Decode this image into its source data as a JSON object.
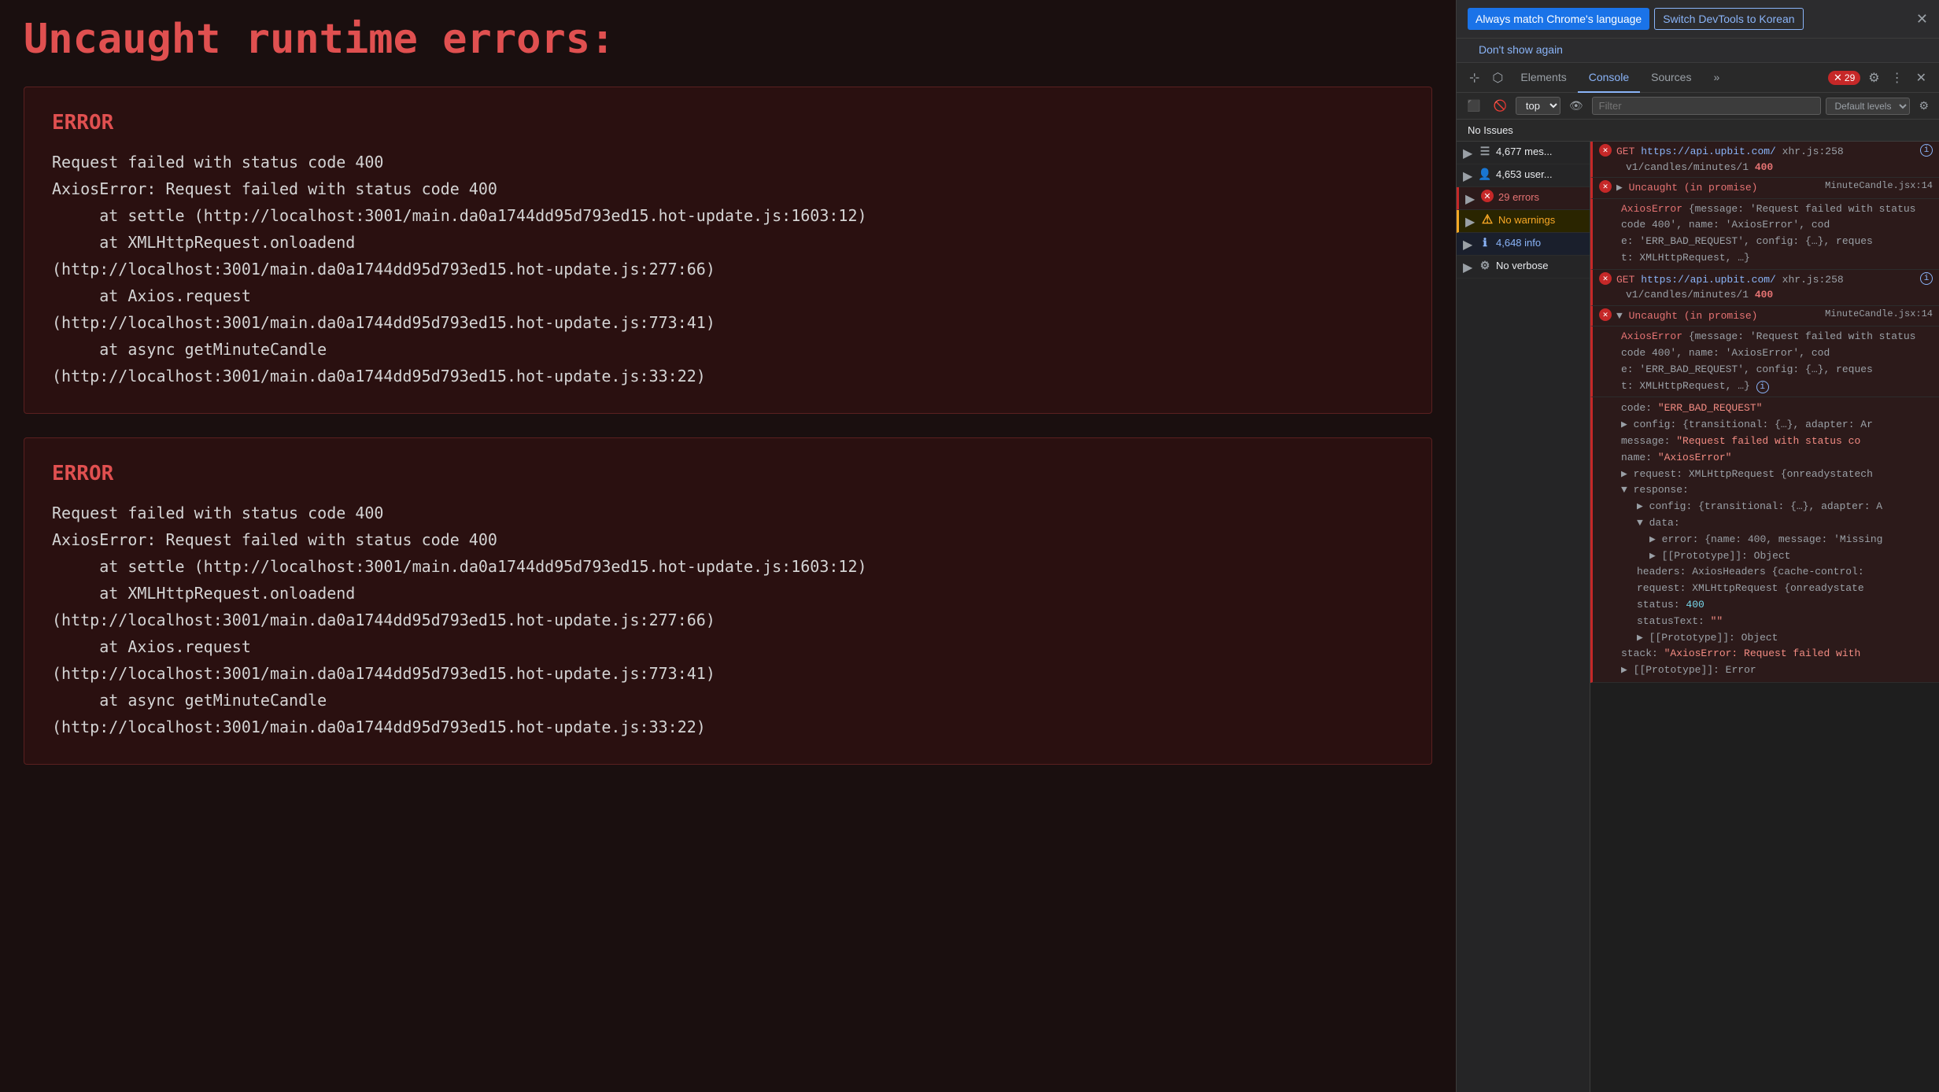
{
  "left": {
    "main_title": "Uncaught runtime errors:",
    "errors": [
      {
        "label": "ERROR",
        "text": "Request failed with status code 400\nAxiosError: Request failed with status code 400\n     at settle (http://localhost:3001/main.da0a1744dd95d793ed15.hot-update.js:1603:12)\n     at XMLHttpRequest.onloadend\n(http://localhost:3001/main.da0a1744dd95d793ed15.hot-update.js:277:66)\n     at Axios.request\n(http://localhost:3001/main.da0a1744dd95d793ed15.hot-update.js:773:41)\n     at async getMinuteCandle\n(http://localhost:3001/main.da0a1744dd95d793ed15.hot-update.js:33:22)"
      },
      {
        "label": "ERROR",
        "text": "Request failed with status code 400\nAxiosError: Request failed with status code 400\n     at settle (http://localhost:3001/main.da0a1744dd95d793ed15.hot-update.js:1603:12)\n     at XMLHttpRequest.onloadend\n(http://localhost:3001/main.da0a1744dd95d793ed15.hot-update.js:277:66)\n     at Axios.request\n(http://localhost:3001/main.da0a1744dd95d793ed15.hot-update.js:773:41)\n     at async getMinuteCandle\n(http://localhost:3001/main.da0a1744dd95d793ed15.hot-update.js:33:22)"
      }
    ]
  },
  "devtools": {
    "lang_banner": {
      "btn_match": "Always match Chrome's language",
      "btn_korean": "Switch DevTools to Korean",
      "dont_show": "Don't show again"
    },
    "tabs": {
      "elements": "Elements",
      "console": "Console",
      "sources": "Sources",
      "more": "»",
      "error_count": "29"
    },
    "toolbar": {
      "top_label": "top",
      "filter_placeholder": "Filter",
      "default_levels": "Default levels"
    },
    "issues_bar": "No Issues",
    "console_entries": [
      {
        "type": "group",
        "icon": "list",
        "count": "4,677 mes...",
        "expanded": false
      },
      {
        "type": "group",
        "icon": "user",
        "count": "4,653 user...",
        "expanded": false
      },
      {
        "type": "errors",
        "icon": "error",
        "count": "29 errors",
        "expanded": false
      },
      {
        "type": "warnings",
        "icon": "warning",
        "count": "No warnings",
        "expanded": false
      },
      {
        "type": "info",
        "icon": "info",
        "count": "4,648 info",
        "expanded": false
      },
      {
        "type": "verbose",
        "icon": "verbose",
        "count": "No verbose",
        "expanded": false
      }
    ],
    "log_entries": [
      {
        "id": "get-1",
        "type": "error",
        "prefix": "GET",
        "url": "https://api.upbit.com/",
        "url_suffix": "xhr.js:258",
        "path": "v1/candles/minutes/1",
        "status": "400",
        "has_info": true
      },
      {
        "id": "uncaught-1",
        "type": "error",
        "prefix": "▶ Uncaught (in promise)",
        "file": "MinuteCandle.jsx:14",
        "expanded": true,
        "sub": {
          "axios_msg": "AxiosError {message: 'Request failed with status code 400', name: 'AxiosError', cod",
          "cont": "e: 'ERR_BAD_REQUEST', config: {…}, reques",
          "end": "t: XMLHttpRequest, …}"
        }
      },
      {
        "id": "get-2",
        "type": "error",
        "prefix": "GET",
        "url": "https://api.upbit.com/",
        "url_suffix": "xhr.js:258",
        "path": "v1/candles/minutes/1",
        "status": "400",
        "has_info": true
      },
      {
        "id": "uncaught-2",
        "type": "error",
        "prefix": "▶ Uncaught (in promise)",
        "file": "MinuteCandle.jsx:14",
        "expanded": true,
        "sub": {
          "axios_msg": "AxiosError {message: 'Request failed with status code 400', name: 'AxiosError', cod",
          "cont": "e: 'ERR_BAD_REQUEST', config: {…}, reques",
          "end": "t: XMLHttpRequest, …}"
        }
      },
      {
        "id": "expanded-block",
        "type": "expanded",
        "lines": [
          {
            "key": "code:",
            "val": "\"ERR_BAD_REQUEST\"",
            "type": "str"
          },
          {
            "key": "▶ config:",
            "val": "{transitional: {…}, adapter: Ar",
            "type": "obj"
          },
          {
            "key": "message:",
            "val": "\"Request failed with status co",
            "type": "str"
          },
          {
            "key": "name:",
            "val": "\"AxiosError\"",
            "type": "str"
          },
          {
            "key": "request:",
            "val": "XMLHttpRequest {onreadystatech",
            "type": "obj"
          },
          {
            "key": "▼ response:",
            "val": "",
            "type": "section"
          },
          {
            "key": "  ▶ config:",
            "val": "{transitional: {…}, adapter: A",
            "type": "obj"
          },
          {
            "key": "  ▼ data:",
            "val": "",
            "type": "section"
          },
          {
            "key": "    ▶ error:",
            "val": "{name: 400, message: 'Missing",
            "type": "obj"
          },
          {
            "key": "    ▶ [[Prototype]]:",
            "val": "Object",
            "type": "obj"
          },
          {
            "key": "  headers:",
            "val": "AxiosHeaders {cache-control:",
            "type": "obj"
          },
          {
            "key": "  request:",
            "val": "XMLHttpRequest {onreadystate",
            "type": "obj"
          },
          {
            "key": "  status:",
            "val": "400",
            "type": "num"
          },
          {
            "key": "  statusText:",
            "val": "\"\"",
            "type": "str"
          },
          {
            "key": "  ▶ [[Prototype]]:",
            "val": "Object",
            "type": "obj"
          },
          {
            "key": "stack:",
            "val": "\"AxiosError: Request failed with",
            "type": "str"
          },
          {
            "key": "  ▶ [[Prototype]]:",
            "val": "Error",
            "type": "obj"
          }
        ]
      }
    ]
  }
}
